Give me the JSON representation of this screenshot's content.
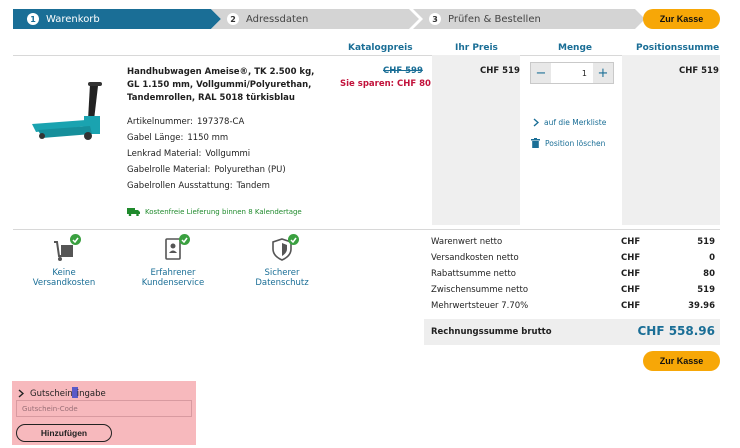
{
  "steps": [
    {
      "num": "1",
      "label": "Warenkorb"
    },
    {
      "num": "2",
      "label": "Adressdaten"
    },
    {
      "num": "3",
      "label": "Prüfen & Bestellen"
    }
  ],
  "checkout_label": "Zur Kasse",
  "columns": {
    "catalog": "Katalogpreis",
    "your_price": "Ihr Preis",
    "quantity": "Menge",
    "position_total": "Positionssumme"
  },
  "product": {
    "title": "Handhubwagen Ameise®, TK 2.500 kg, GL 1.150 mm, Vollgummi/Polyurethan, Tandemrollen, RAL 5018 türkisblau",
    "attributes": [
      {
        "label": "Artikelnummer:",
        "value": "197378-CA"
      },
      {
        "label": "Gabel Länge:",
        "value": "1150 mm"
      },
      {
        "label": "Lenkrad Material:",
        "value": "Vollgummi"
      },
      {
        "label": "Gabelrolle Material:",
        "value": "Polyurethan (PU)"
      },
      {
        "label": "Gabelrollen Ausstattung:",
        "value": "Tandem"
      }
    ],
    "delivery": "Kostenfreie Lieferung binnen 8 Kalendertage",
    "catalog_price": "CHF 599",
    "savings": "Sie sparen: CHF 80",
    "your_price": "CHF 519",
    "quantity": "1",
    "position_total": "CHF 519",
    "wishlist_link": "auf die Merkliste",
    "delete_link": "Position löschen"
  },
  "features": [
    {
      "label": "Keine Versandkosten",
      "icon": "shipping-icon"
    },
    {
      "label": "Erfahrener Kundenservice",
      "icon": "service-icon"
    },
    {
      "label": "Sicherer Datenschutz",
      "icon": "shield-icon"
    }
  ],
  "summary": [
    {
      "label": "Warenwert netto",
      "currency": "CHF",
      "amount": "519"
    },
    {
      "label": "Versandkosten netto",
      "currency": "CHF",
      "amount": "0"
    },
    {
      "label": "Rabattsumme netto",
      "currency": "CHF",
      "amount": "80"
    },
    {
      "label": "Zwischensumme netto",
      "currency": "CHF",
      "amount": "519"
    },
    {
      "label": "Mehrwertsteuer 7.70%",
      "currency": "CHF",
      "amount": "39.96"
    }
  ],
  "total": {
    "label": "Rechnungssumme brutto",
    "amount": "CHF 558.96"
  },
  "coupon": {
    "title_before": "Gutschein",
    "title_after": "ingabe",
    "placeholder": "Gutschein-Code",
    "button": "Hinzufügen"
  },
  "colors": {
    "primary": "#1a6e96",
    "accent": "#f7a707",
    "savings": "#c2123b",
    "success": "#3aa040"
  }
}
